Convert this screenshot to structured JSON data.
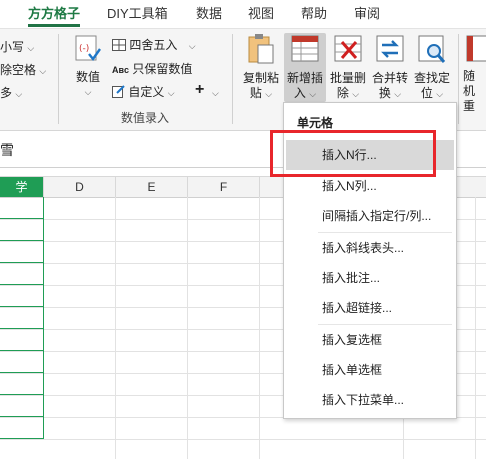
{
  "tabs": [
    "方方格子",
    "DIY工具箱",
    "数据",
    "视图",
    "帮助",
    "审阅"
  ],
  "ribbon": {
    "left_fragments": [
      "小写",
      "除空格",
      "多"
    ],
    "numeric_label": "数值",
    "round_label": "四舍五入",
    "keep_value_label": "只保留数值",
    "custom_label": "自定义",
    "abc_badge": "Aʙc",
    "plus_symbol": "+",
    "group_label": "数值录入",
    "copy_paste_line1": "复制粘",
    "copy_paste_line2": "贴",
    "insert_line1": "新增插",
    "insert_line2": "入",
    "batch_delete_line1": "批量删",
    "batch_delete_line2": "除",
    "merge_line1": "合并转",
    "merge_line2": "换",
    "find_line1": "查找定",
    "find_line2": "位",
    "random_line1": "随机",
    "random_line2": "重"
  },
  "formula_bar": {
    "value": "雪"
  },
  "columns": [
    "学",
    "D",
    "E",
    "F"
  ],
  "menu": {
    "header": "单元格",
    "items": [
      "插入N行...",
      "插入N列...",
      "间隔插入指定行/列...",
      "插入斜线表头...",
      "插入批注...",
      "插入超链接...",
      "插入复选框",
      "插入单选框",
      "插入下拉菜单..."
    ],
    "highlighted_index": 0
  },
  "colors": {
    "accent": "#217346",
    "highlight_box": "#e8262b",
    "menu_hover": "#d9d9d9"
  }
}
